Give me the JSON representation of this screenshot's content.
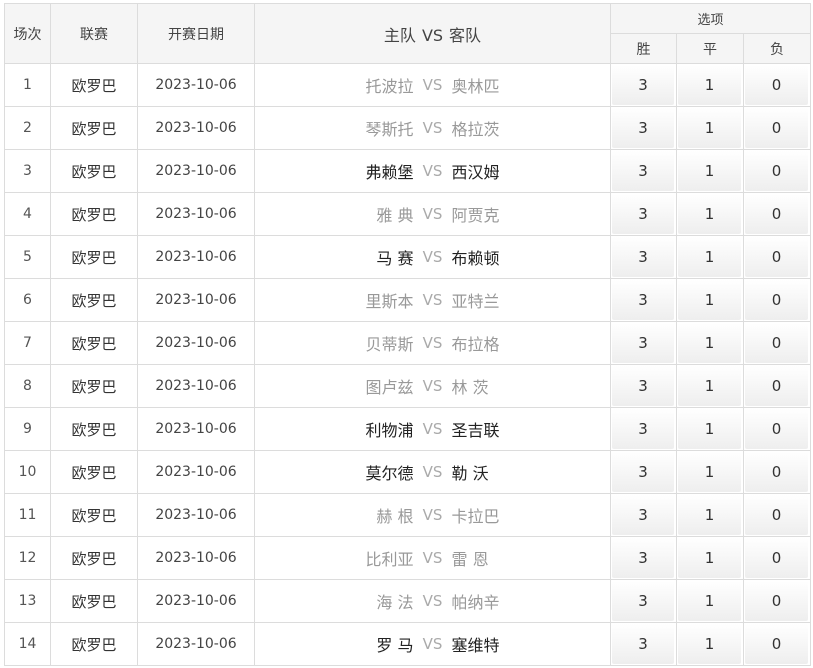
{
  "header": {
    "index": "场次",
    "league": "联赛",
    "date": "开赛日期",
    "home": "主队",
    "vs": "VS",
    "away": "客队",
    "options": "选项",
    "win": "胜",
    "draw": "平",
    "lose": "负"
  },
  "colors": {
    "strong_text": "#222222",
    "muted_text": "#999999",
    "vs_gray": "#aaaaaa"
  },
  "rows": [
    {
      "index": "1",
      "league": "欧罗巴",
      "date": "2023-10-06",
      "home": "托波拉",
      "away": "奥林匹",
      "vs": "VS",
      "win": "3",
      "draw": "1",
      "lose": "0",
      "home_style": "muted",
      "away_style": "muted"
    },
    {
      "index": "2",
      "league": "欧罗巴",
      "date": "2023-10-06",
      "home": "琴斯托",
      "away": "格拉茨",
      "vs": "VS",
      "win": "3",
      "draw": "1",
      "lose": "0",
      "home_style": "muted",
      "away_style": "muted"
    },
    {
      "index": "3",
      "league": "欧罗巴",
      "date": "2023-10-06",
      "home": "弗赖堡",
      "away": "西汉姆",
      "vs": "VS",
      "win": "3",
      "draw": "1",
      "lose": "0",
      "home_style": "strong",
      "away_style": "strong"
    },
    {
      "index": "4",
      "league": "欧罗巴",
      "date": "2023-10-06",
      "home": "雅 典",
      "away": "阿贾克",
      "vs": "VS",
      "win": "3",
      "draw": "1",
      "lose": "0",
      "home_style": "muted",
      "away_style": "muted"
    },
    {
      "index": "5",
      "league": "欧罗巴",
      "date": "2023-10-06",
      "home": "马 赛",
      "away": "布赖顿",
      "vs": "VS",
      "win": "3",
      "draw": "1",
      "lose": "0",
      "home_style": "strong",
      "away_style": "strong"
    },
    {
      "index": "6",
      "league": "欧罗巴",
      "date": "2023-10-06",
      "home": "里斯本",
      "away": "亚特兰",
      "vs": "VS",
      "win": "3",
      "draw": "1",
      "lose": "0",
      "home_style": "muted",
      "away_style": "muted"
    },
    {
      "index": "7",
      "league": "欧罗巴",
      "date": "2023-10-06",
      "home": "贝蒂斯",
      "away": "布拉格",
      "vs": "VS",
      "win": "3",
      "draw": "1",
      "lose": "0",
      "home_style": "muted",
      "away_style": "muted"
    },
    {
      "index": "8",
      "league": "欧罗巴",
      "date": "2023-10-06",
      "home": "图卢兹",
      "away": "林 茨",
      "vs": "VS",
      "win": "3",
      "draw": "1",
      "lose": "0",
      "home_style": "muted",
      "away_style": "muted"
    },
    {
      "index": "9",
      "league": "欧罗巴",
      "date": "2023-10-06",
      "home": "利物浦",
      "away": "圣吉联",
      "vs": "VS",
      "win": "3",
      "draw": "1",
      "lose": "0",
      "home_style": "strong",
      "away_style": "strong"
    },
    {
      "index": "10",
      "league": "欧罗巴",
      "date": "2023-10-06",
      "home": "莫尔德",
      "away": "勒 沃",
      "vs": "VS",
      "win": "3",
      "draw": "1",
      "lose": "0",
      "home_style": "strong",
      "away_style": "strong"
    },
    {
      "index": "11",
      "league": "欧罗巴",
      "date": "2023-10-06",
      "home": "赫 根",
      "away": "卡拉巴",
      "vs": "VS",
      "win": "3",
      "draw": "1",
      "lose": "0",
      "home_style": "muted",
      "away_style": "muted"
    },
    {
      "index": "12",
      "league": "欧罗巴",
      "date": "2023-10-06",
      "home": "比利亚",
      "away": "雷 恩",
      "vs": "VS",
      "win": "3",
      "draw": "1",
      "lose": "0",
      "home_style": "muted",
      "away_style": "muted"
    },
    {
      "index": "13",
      "league": "欧罗巴",
      "date": "2023-10-06",
      "home": "海 法",
      "away": "帕纳辛",
      "vs": "VS",
      "win": "3",
      "draw": "1",
      "lose": "0",
      "home_style": "muted",
      "away_style": "muted"
    },
    {
      "index": "14",
      "league": "欧罗巴",
      "date": "2023-10-06",
      "home": "罗 马",
      "away": "塞维特",
      "vs": "VS",
      "win": "3",
      "draw": "1",
      "lose": "0",
      "home_style": "strong",
      "away_style": "strong"
    }
  ]
}
